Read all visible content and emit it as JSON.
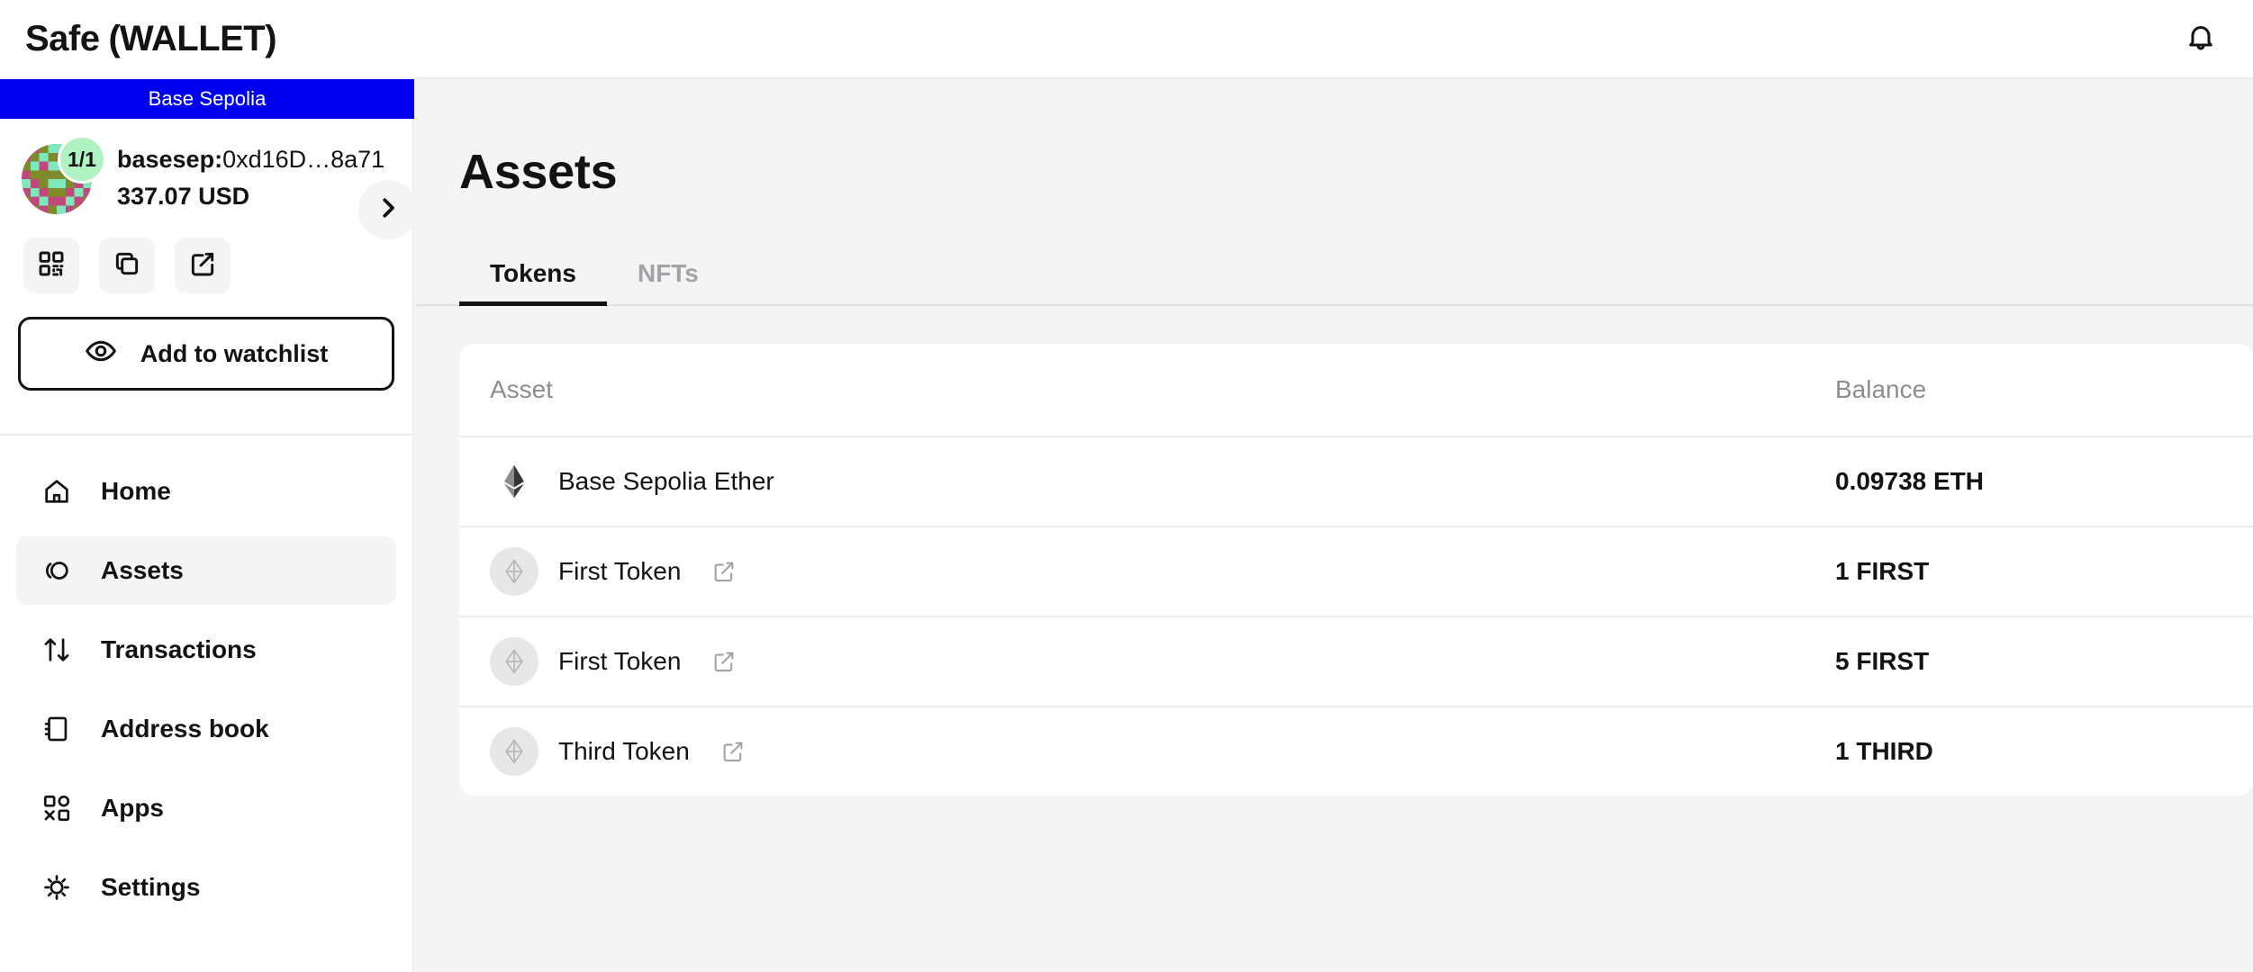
{
  "app": {
    "brand_prefix": "Safe",
    "brand_bracket_open": "(",
    "brand_name": "WALLET",
    "brand_bracket_close": ")",
    "bell_icon": "bell-icon"
  },
  "sidebar": {
    "network": "Base Sepolia",
    "network_color": "#0000ee",
    "account": {
      "threshold": "1/1",
      "name_prefix": "basesep:",
      "address": "0xd16D…8a71",
      "fiat_balance": "337.07 USD",
      "badge_color": "#b0f2c2"
    },
    "quick_actions": [
      {
        "name": "qr-code-icon",
        "label": "Show QR code"
      },
      {
        "name": "copy-icon",
        "label": "Copy address"
      },
      {
        "name": "external-link-icon",
        "label": "View on block explorer"
      }
    ],
    "watchlist_button": {
      "label": "Add to watchlist",
      "icon": "eye-icon"
    },
    "collapse_button": {
      "icon": "chevron-right-icon"
    },
    "nav_items": [
      {
        "label": "Home",
        "icon": "home-icon",
        "active": false
      },
      {
        "label": "Assets",
        "icon": "assets-icon",
        "active": true
      },
      {
        "label": "Transactions",
        "icon": "transactions-icon",
        "active": false
      },
      {
        "label": "Address book",
        "icon": "address-book-icon",
        "active": false
      },
      {
        "label": "Apps",
        "icon": "apps-icon",
        "active": false
      },
      {
        "label": "Settings",
        "icon": "settings-icon",
        "active": false
      }
    ]
  },
  "main": {
    "page_title": "Assets",
    "tabs": [
      {
        "label": "Tokens",
        "active": true
      },
      {
        "label": "NFTs",
        "active": false
      }
    ],
    "table": {
      "columns": {
        "asset": "Asset",
        "balance": "Balance"
      },
      "rows": [
        {
          "name": "Base Sepolia Ether",
          "balance": "0.09738 ETH",
          "logo": "ethereum-logo-icon",
          "has_external_link": false
        },
        {
          "name": "First Token",
          "balance": "1 FIRST",
          "logo": "token-placeholder-icon",
          "has_external_link": true
        },
        {
          "name": "First Token",
          "balance": "5 FIRST",
          "logo": "token-placeholder-icon",
          "has_external_link": true
        },
        {
          "name": "Third Token",
          "balance": "1 THIRD",
          "logo": "token-placeholder-icon",
          "has_external_link": true
        }
      ]
    }
  }
}
